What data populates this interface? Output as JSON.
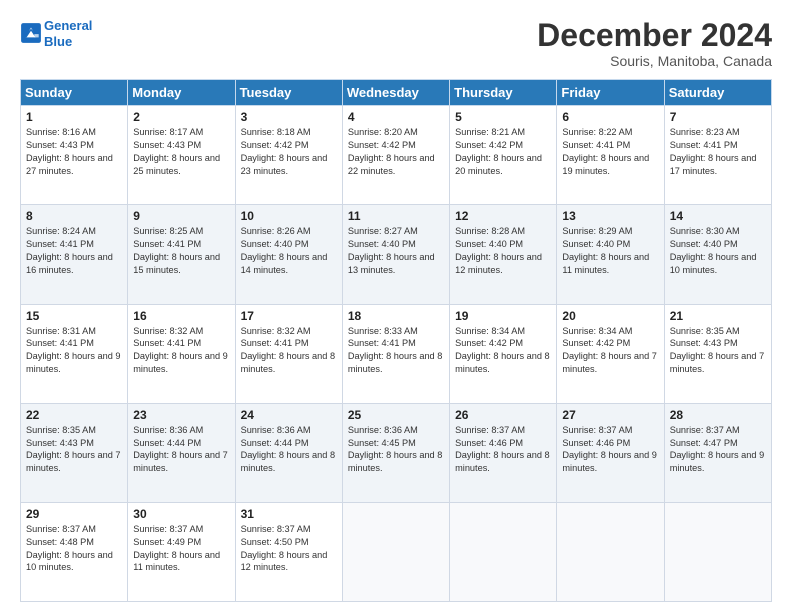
{
  "logo": {
    "line1": "General",
    "line2": "Blue"
  },
  "title": "December 2024",
  "subtitle": "Souris, Manitoba, Canada",
  "header_days": [
    "Sunday",
    "Monday",
    "Tuesday",
    "Wednesday",
    "Thursday",
    "Friday",
    "Saturday"
  ],
  "weeks": [
    [
      {
        "day": "1",
        "sunrise": "8:16 AM",
        "sunset": "4:43 PM",
        "daylight": "8 hours and 27 minutes."
      },
      {
        "day": "2",
        "sunrise": "8:17 AM",
        "sunset": "4:43 PM",
        "daylight": "8 hours and 25 minutes."
      },
      {
        "day": "3",
        "sunrise": "8:18 AM",
        "sunset": "4:42 PM",
        "daylight": "8 hours and 23 minutes."
      },
      {
        "day": "4",
        "sunrise": "8:20 AM",
        "sunset": "4:42 PM",
        "daylight": "8 hours and 22 minutes."
      },
      {
        "day": "5",
        "sunrise": "8:21 AM",
        "sunset": "4:42 PM",
        "daylight": "8 hours and 20 minutes."
      },
      {
        "day": "6",
        "sunrise": "8:22 AM",
        "sunset": "4:41 PM",
        "daylight": "8 hours and 19 minutes."
      },
      {
        "day": "7",
        "sunrise": "8:23 AM",
        "sunset": "4:41 PM",
        "daylight": "8 hours and 17 minutes."
      }
    ],
    [
      {
        "day": "8",
        "sunrise": "8:24 AM",
        "sunset": "4:41 PM",
        "daylight": "8 hours and 16 minutes."
      },
      {
        "day": "9",
        "sunrise": "8:25 AM",
        "sunset": "4:41 PM",
        "daylight": "8 hours and 15 minutes."
      },
      {
        "day": "10",
        "sunrise": "8:26 AM",
        "sunset": "4:40 PM",
        "daylight": "8 hours and 14 minutes."
      },
      {
        "day": "11",
        "sunrise": "8:27 AM",
        "sunset": "4:40 PM",
        "daylight": "8 hours and 13 minutes."
      },
      {
        "day": "12",
        "sunrise": "8:28 AM",
        "sunset": "4:40 PM",
        "daylight": "8 hours and 12 minutes."
      },
      {
        "day": "13",
        "sunrise": "8:29 AM",
        "sunset": "4:40 PM",
        "daylight": "8 hours and 11 minutes."
      },
      {
        "day": "14",
        "sunrise": "8:30 AM",
        "sunset": "4:40 PM",
        "daylight": "8 hours and 10 minutes."
      }
    ],
    [
      {
        "day": "15",
        "sunrise": "8:31 AM",
        "sunset": "4:41 PM",
        "daylight": "8 hours and 9 minutes."
      },
      {
        "day": "16",
        "sunrise": "8:32 AM",
        "sunset": "4:41 PM",
        "daylight": "8 hours and 9 minutes."
      },
      {
        "day": "17",
        "sunrise": "8:32 AM",
        "sunset": "4:41 PM",
        "daylight": "8 hours and 8 minutes."
      },
      {
        "day": "18",
        "sunrise": "8:33 AM",
        "sunset": "4:41 PM",
        "daylight": "8 hours and 8 minutes."
      },
      {
        "day": "19",
        "sunrise": "8:34 AM",
        "sunset": "4:42 PM",
        "daylight": "8 hours and 8 minutes."
      },
      {
        "day": "20",
        "sunrise": "8:34 AM",
        "sunset": "4:42 PM",
        "daylight": "8 hours and 7 minutes."
      },
      {
        "day": "21",
        "sunrise": "8:35 AM",
        "sunset": "4:43 PM",
        "daylight": "8 hours and 7 minutes."
      }
    ],
    [
      {
        "day": "22",
        "sunrise": "8:35 AM",
        "sunset": "4:43 PM",
        "daylight": "8 hours and 7 minutes."
      },
      {
        "day": "23",
        "sunrise": "8:36 AM",
        "sunset": "4:44 PM",
        "daylight": "8 hours and 7 minutes."
      },
      {
        "day": "24",
        "sunrise": "8:36 AM",
        "sunset": "4:44 PM",
        "daylight": "8 hours and 8 minutes."
      },
      {
        "day": "25",
        "sunrise": "8:36 AM",
        "sunset": "4:45 PM",
        "daylight": "8 hours and 8 minutes."
      },
      {
        "day": "26",
        "sunrise": "8:37 AM",
        "sunset": "4:46 PM",
        "daylight": "8 hours and 8 minutes."
      },
      {
        "day": "27",
        "sunrise": "8:37 AM",
        "sunset": "4:46 PM",
        "daylight": "8 hours and 9 minutes."
      },
      {
        "day": "28",
        "sunrise": "8:37 AM",
        "sunset": "4:47 PM",
        "daylight": "8 hours and 9 minutes."
      }
    ],
    [
      {
        "day": "29",
        "sunrise": "8:37 AM",
        "sunset": "4:48 PM",
        "daylight": "8 hours and 10 minutes."
      },
      {
        "day": "30",
        "sunrise": "8:37 AM",
        "sunset": "4:49 PM",
        "daylight": "8 hours and 11 minutes."
      },
      {
        "day": "31",
        "sunrise": "8:37 AM",
        "sunset": "4:50 PM",
        "daylight": "8 hours and 12 minutes."
      },
      null,
      null,
      null,
      null
    ]
  ],
  "labels": {
    "sunrise": "Sunrise:",
    "sunset": "Sunset:",
    "daylight": "Daylight:"
  }
}
